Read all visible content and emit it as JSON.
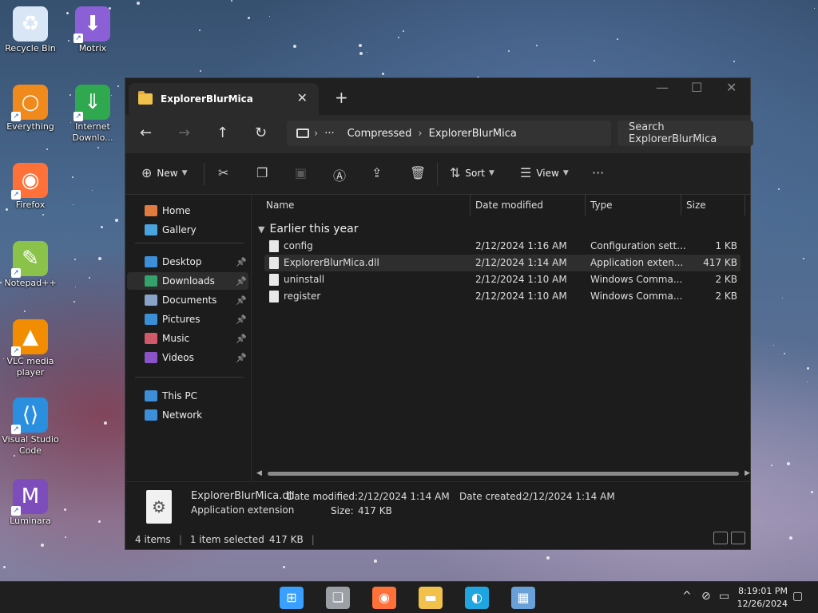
{
  "desktop": {
    "icons": [
      {
        "label": "Recycle Bin",
        "icon": "recycle-bin-icon",
        "color": "#d8e6f6"
      },
      {
        "label": "Motrix",
        "icon": "motrix-icon",
        "color": "#8b5fd6"
      },
      {
        "label": "Everything",
        "icon": "everything-search-icon",
        "color": "#f08a1c"
      },
      {
        "label": "Internet Downlo...",
        "icon": "internet-download-manager-icon",
        "color": "#2fa84f"
      },
      {
        "label": "Firefox",
        "icon": "firefox-icon",
        "color": "#ff7139"
      },
      {
        "label": "Notepad++",
        "icon": "notepad-plus-plus-icon",
        "color": "#8bc34a"
      },
      {
        "label": "VLC media player",
        "icon": "vlc-icon",
        "color": "#f28c00"
      },
      {
        "label": "Visual Studio Code",
        "icon": "vscode-icon",
        "color": "#2b8fe0"
      },
      {
        "label": "Luminara",
        "icon": "luminara-icon",
        "color": "#7c4dbb"
      }
    ]
  },
  "window": {
    "tab_title": "ExplorerBlurMica",
    "address": {
      "overflow": "···",
      "segments": [
        "Compressed",
        "ExplorerBlurMica"
      ]
    },
    "search_placeholder": "Search ExplorerBlurMica",
    "toolbar": {
      "new_label": "New",
      "sort_label": "Sort",
      "view_label": "View",
      "more_label": "···"
    },
    "sidebar": {
      "top": [
        {
          "label": "Home",
          "icon": "home-icon",
          "color": "#e07a3f"
        },
        {
          "label": "Gallery",
          "icon": "gallery-icon",
          "color": "#4aa3df"
        }
      ],
      "quick": [
        {
          "label": "Desktop",
          "icon": "desktop-icon",
          "color": "#3c8fd8",
          "pinned": true
        },
        {
          "label": "Downloads",
          "icon": "downloads-icon",
          "color": "#33a36b",
          "pinned": true,
          "selected": true
        },
        {
          "label": "Documents",
          "icon": "documents-icon",
          "color": "#8aa2c8",
          "pinned": true
        },
        {
          "label": "Pictures",
          "icon": "pictures-icon",
          "color": "#3b8fd6",
          "pinned": true
        },
        {
          "label": "Music",
          "icon": "music-icon",
          "color": "#d15a6a",
          "pinned": true
        },
        {
          "label": "Videos",
          "icon": "videos-icon",
          "color": "#8c53c9",
          "pinned": true
        }
      ],
      "bottom": [
        {
          "label": "This PC",
          "icon": "this-pc-icon",
          "color": "#3c8fd8"
        },
        {
          "label": "Network",
          "icon": "network-icon",
          "color": "#3c8fd8"
        }
      ]
    },
    "columns": {
      "name": "Name",
      "date": "Date modified",
      "type": "Type",
      "size": "Size"
    },
    "group_label": "Earlier this year",
    "files": [
      {
        "name": "config",
        "date": "2/12/2024 1:16 AM",
        "type": "Configuration sett...",
        "size": "1 KB"
      },
      {
        "name": "ExplorerBlurMica.dll",
        "date": "2/12/2024 1:14 AM",
        "type": "Application exten...",
        "size": "417 KB",
        "selected": true
      },
      {
        "name": "uninstall",
        "date": "2/12/2024 1:10 AM",
        "type": "Windows Comma...",
        "size": "2 KB"
      },
      {
        "name": "register",
        "date": "2/12/2024 1:10 AM",
        "type": "Windows Comma...",
        "size": "2 KB"
      }
    ],
    "details": {
      "filename": "ExplorerBlurMica.dll",
      "filetype": "Application extension",
      "modified_label": "Date modified:",
      "modified_value": "2/12/2024 1:14 AM",
      "size_label": "Size:",
      "size_value": "417 KB",
      "created_label": "Date created:",
      "created_value": "2/12/2024 1:14 AM"
    },
    "status": {
      "items": "4 items",
      "selected": "1 item selected",
      "selected_size": "417 KB"
    }
  },
  "taskbar": {
    "apps": [
      {
        "icon": "start-icon",
        "color": "#3aa0ff"
      },
      {
        "icon": "task-view-icon",
        "color": "#9aa0a6"
      },
      {
        "icon": "firefox-icon",
        "color": "#ff7139"
      },
      {
        "icon": "file-explorer-icon",
        "color": "#f2c14b"
      },
      {
        "icon": "edge-icon",
        "color": "#1fa6e0"
      },
      {
        "icon": "control-panel-icon",
        "color": "#6aa0d8"
      }
    ],
    "clock_time": "8:19:01 PM",
    "clock_date": "12/26/2024"
  }
}
